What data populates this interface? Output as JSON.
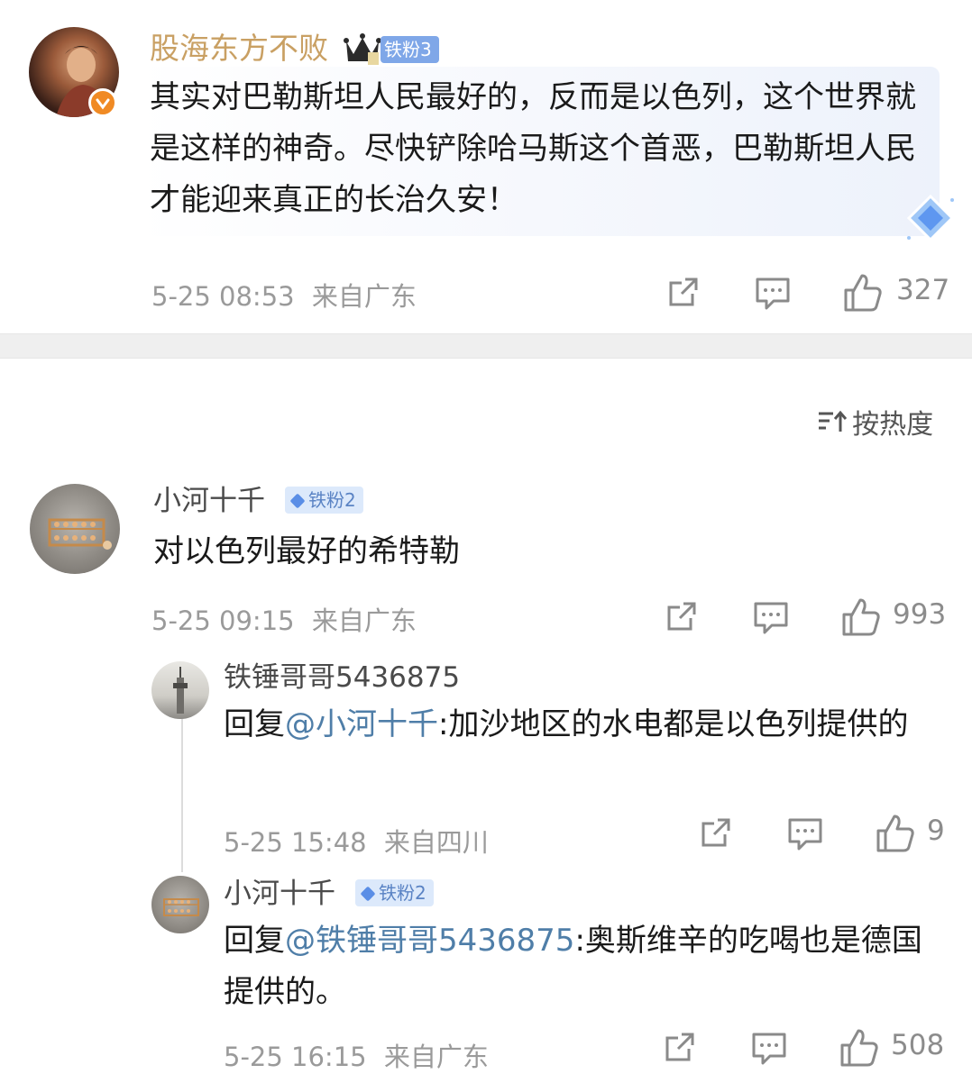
{
  "post": {
    "username": "股海东方不败",
    "fan_badge": "铁粉3",
    "text": "其实对巴勒斯坦人民最好的，反而是以色列，这个世界就是这样的神奇。尽快铲除哈马斯这个首恶，巴勒斯坦人民才能迎来真正的长治久安！",
    "time": "5-25 08:53",
    "location": "来自广东",
    "likes": "327"
  },
  "sort": {
    "label": "按热度"
  },
  "comments": [
    {
      "username": "小河十千",
      "fan_badge": "铁粉2",
      "text": "对以色列最好的希特勒",
      "time": "5-25 09:15",
      "location": "来自广东",
      "likes": "993",
      "replies": [
        {
          "username": "铁锤哥哥5436875",
          "reply_prefix": "回复",
          "mention": "@小河十千",
          "text": ":加沙地区的水电都是以色列提供的",
          "time": "5-25 15:48",
          "location": "来自四川",
          "likes": "9"
        },
        {
          "username": "小河十千",
          "fan_badge": "铁粉2",
          "reply_prefix": "回复",
          "mention": "@铁锤哥哥5436875",
          "text": ":奥斯维辛的吃喝也是德国提供的。",
          "time": "5-25 16:15",
          "location": "来自广东",
          "likes": "508"
        }
      ]
    }
  ],
  "icons": {
    "share": "share-icon",
    "comment": "comment-icon",
    "like": "thumbs-up-icon",
    "verified": "verified-badge-icon",
    "crown": "crown-icon",
    "sort": "sort-icon"
  },
  "colors": {
    "username_gold": "#c9a063",
    "mention_blue": "#4f7ea8",
    "meta_gray": "#9a9a9a",
    "divider_gray": "#efefef",
    "badge_bg": "#dce9fb"
  }
}
